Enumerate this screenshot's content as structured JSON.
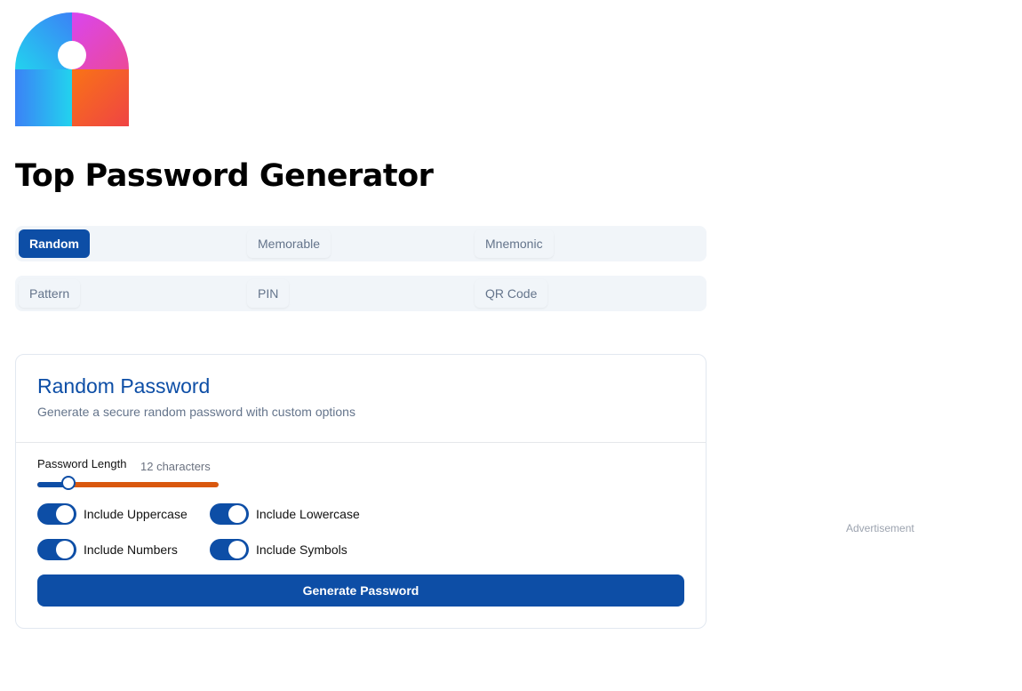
{
  "app": {
    "title": "Top Password Generator",
    "logo_icon": "keyhole-logo-icon"
  },
  "tabs": [
    {
      "label": "Random",
      "active": true
    },
    {
      "label": "Memorable",
      "active": false
    },
    {
      "label": "Mnemonic",
      "active": false
    },
    {
      "label": "Pattern",
      "active": false
    },
    {
      "label": "PIN",
      "active": false
    },
    {
      "label": "QR Code",
      "active": false
    }
  ],
  "card": {
    "title": "Random Password",
    "subtitle": "Generate a secure random password with custom options",
    "length": {
      "label": "Password Length",
      "value_text": "12 characters",
      "slider_fraction": 0.17
    },
    "options": [
      {
        "label": "Include Uppercase",
        "on": true
      },
      {
        "label": "Include Lowercase",
        "on": true
      },
      {
        "label": "Include Numbers",
        "on": true
      },
      {
        "label": "Include Symbols",
        "on": true
      }
    ],
    "generate_label": "Generate Password"
  },
  "ad": {
    "label": "Advertisement"
  },
  "colors": {
    "primary": "#0d4ea6",
    "slider_rest": "#d9580e",
    "tab_bg": "#f1f5f9",
    "muted_text": "#64748b"
  }
}
